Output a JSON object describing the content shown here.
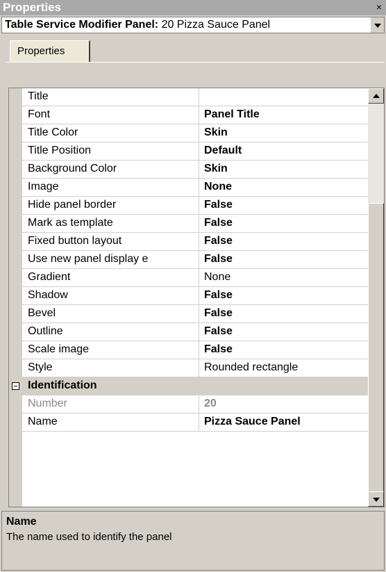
{
  "window": {
    "title": "Properties",
    "close_glyph": "×"
  },
  "selector": {
    "object_type": "Table Service Modifier Panel:",
    "object_name": "20 Pizza Sauce Panel"
  },
  "tabs": [
    {
      "label": "Properties"
    }
  ],
  "properties": [
    {
      "name": "Title",
      "value": "",
      "bold": false
    },
    {
      "name": "Font",
      "value": "Panel Title",
      "bold": true
    },
    {
      "name": "Title Color",
      "value": "Skin",
      "bold": true
    },
    {
      "name": "Title Position",
      "value": "Default",
      "bold": true
    },
    {
      "name": "Background Color",
      "value": "Skin",
      "bold": true
    },
    {
      "name": "Image",
      "value": "None",
      "bold": true
    },
    {
      "name": "Hide panel border",
      "value": "False",
      "bold": true
    },
    {
      "name": "Mark as template",
      "value": "False",
      "bold": true
    },
    {
      "name": "Fixed button layout",
      "value": "False",
      "bold": true
    },
    {
      "name": "Use new panel display e",
      "value": "False",
      "bold": true
    },
    {
      "name": "Gradient",
      "value": "None",
      "bold": false
    },
    {
      "name": "Shadow",
      "value": "False",
      "bold": true
    },
    {
      "name": "Bevel",
      "value": "False",
      "bold": true
    },
    {
      "name": "Outline",
      "value": "False",
      "bold": true
    },
    {
      "name": "Scale image",
      "value": "False",
      "bold": true
    },
    {
      "name": "Style",
      "value": "Rounded rectangle",
      "bold": false
    }
  ],
  "identification": {
    "category": "Identification",
    "rows": [
      {
        "name": "Number",
        "value": "20",
        "bold": true,
        "dim": true
      },
      {
        "name": "Name",
        "value": "Pizza Sauce Panel",
        "bold": true,
        "dim": false
      }
    ]
  },
  "description": {
    "title": "Name",
    "text": "The name used to identify the panel"
  }
}
